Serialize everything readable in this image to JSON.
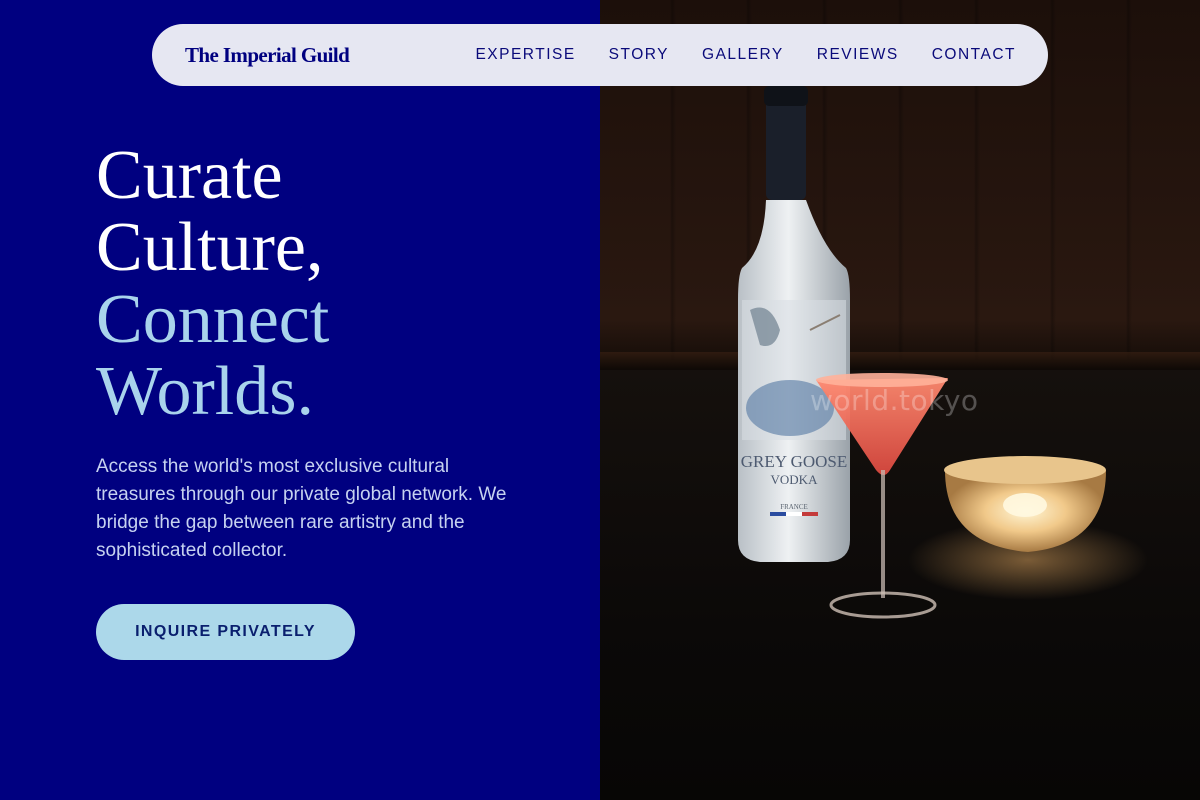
{
  "nav": {
    "brand": "The Imperial Guild",
    "links": [
      "EXPERTISE",
      "STORY",
      "GALLERY",
      "REVIEWS",
      "CONTACT"
    ]
  },
  "hero": {
    "title_line1": "Curate",
    "title_line2": "Culture,",
    "title_accent1": "Connect",
    "title_accent2": "Worlds.",
    "description": "Access the world's most exclusive cultural treasures through our private global network. We bridge the gap between rare artistry and the sophisticated collector.",
    "cta_label": "INQUIRE PRIVATELY"
  },
  "photo": {
    "watermark": "world.tokyo",
    "bottle_label_brand": "GREY GOOSE",
    "bottle_label_type": "VODKA",
    "bottle_label_origin": "FRANCE"
  },
  "colors": {
    "background": "#000080",
    "nav_background": "#e6e7f2",
    "accent": "#a9d3ec",
    "cta_background": "#acd8ea"
  }
}
